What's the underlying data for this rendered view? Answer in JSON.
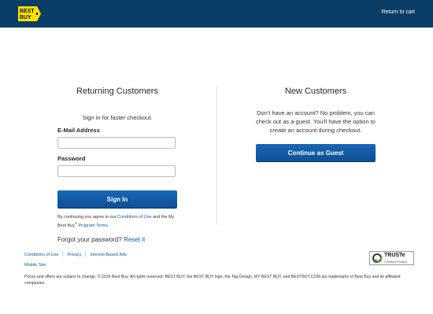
{
  "header": {
    "logo_text": "BEST BUY",
    "return_label": "Return to cart"
  },
  "returning": {
    "title": "Returning Customers",
    "subtitle": "Sign in for faster checkout.",
    "email_label": "E-Mail Address",
    "email_value": "",
    "password_label": "Password",
    "password_value": "",
    "signin_label": "Sign In",
    "agree_prefix": "By continuing you agree to our",
    "conditions_link": "Conditions of Use",
    "agree_middle": "and the My Best Buy",
    "agree_reg": "®",
    "program_terms_link": "Program Terms.",
    "forgot_text": "Forgot your password?",
    "reset_link": "Reset it"
  },
  "new_customers": {
    "title": "New Customers",
    "subtitle": "Don't have an account? No problem, you can check out as a guest. You'll have the option to create an account during checkout.",
    "guest_label": "Continue as Guest"
  },
  "footer": {
    "links": [
      "Conditions of Use",
      "Privacy",
      "Interest-Based Ads"
    ],
    "mobile_site": "Mobile Site",
    "copyright": "Prices and offers are subject to change. © 2016 Best Buy. All rights reserved. BEST BUY, the BEST BUY logo, the Tag Design, MY BEST BUY, and BESTBUY.COM are trademarks of Best Buy and its affiliated companies.",
    "truste_title": "TRUSTe",
    "truste_sub": "Certified Privacy"
  },
  "colors": {
    "header_bg": "#0a3d66",
    "button_blue": "#1767b5",
    "link_blue": "#0b5aa5",
    "logo_yellow": "#ffe000"
  }
}
